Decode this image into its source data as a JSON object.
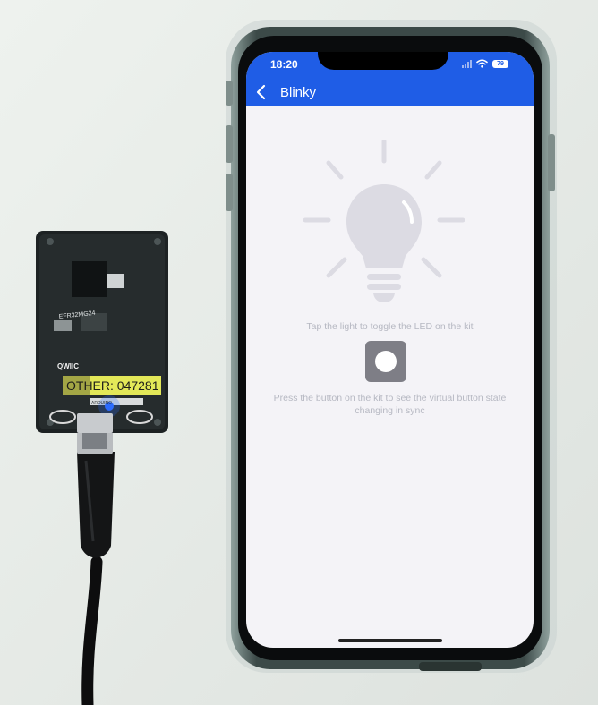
{
  "status_bar": {
    "time": "18:20",
    "battery": "79"
  },
  "nav": {
    "title": "Blinky",
    "back_icon": "chevron-left-icon"
  },
  "blinky": {
    "light_hint": "Tap the light to toggle the LED on the kit",
    "button_hint": "Press the button on the kit to see the virtual button state changing in sync",
    "led_state": "off",
    "button_state": "released"
  },
  "board": {
    "label": "OTHER: 047281",
    "chip": "EFR32MG24",
    "connector": "QWIIC",
    "logo": "ARDUINO",
    "led_color": "#2c6bff"
  },
  "colors": {
    "app_bar": "#1f5de6",
    "screen_bg": "#f4f3f7",
    "bulb_off": "#dcdbe3",
    "sticker": "#e3e858"
  }
}
